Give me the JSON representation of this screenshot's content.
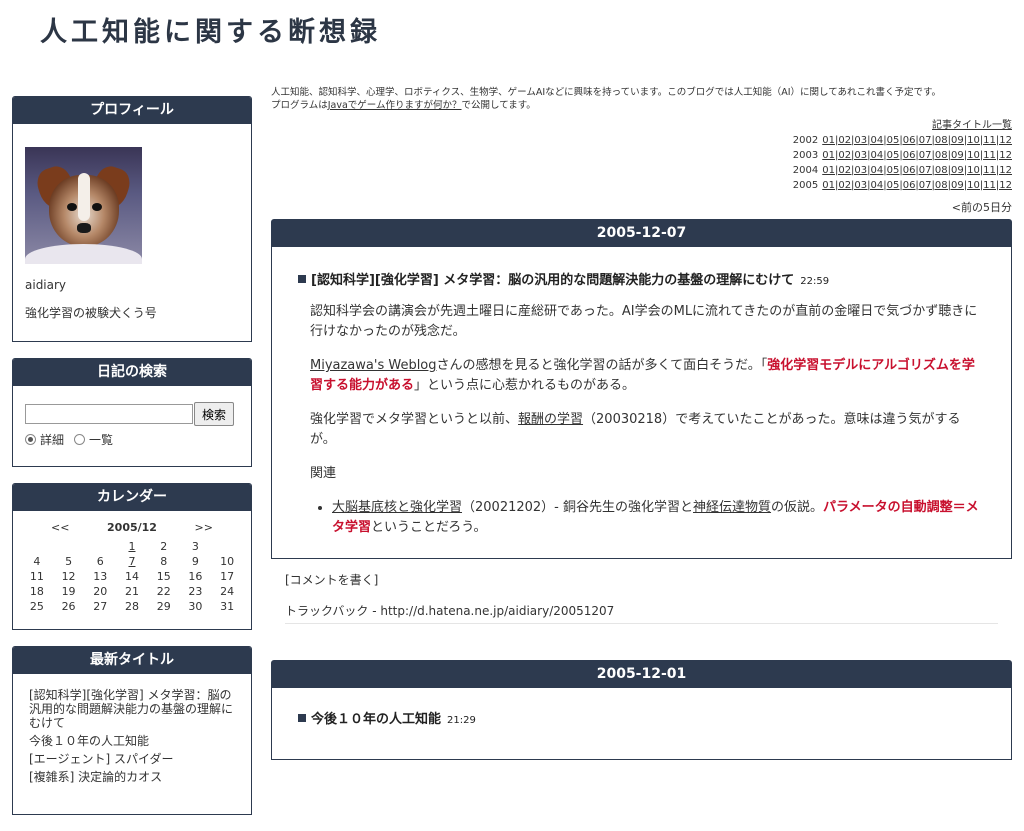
{
  "site": {
    "title": "人工知能に関する断想録"
  },
  "sidebar": {
    "profile": {
      "heading": "プロフィール",
      "name": "aidiary",
      "description": "強化学習の被験犬くう号"
    },
    "search": {
      "heading": "日記の検索",
      "input_value": "",
      "button_label": "検索",
      "options": [
        "詳細",
        "一覧"
      ],
      "selected": "詳細"
    },
    "calendar": {
      "heading": "カレンダー",
      "prev": "<<",
      "month": "2005/12",
      "next": ">>",
      "weeks": [
        [
          "",
          "",
          "",
          "1",
          "2",
          "3",
          ""
        ],
        [
          "4",
          "5",
          "6",
          "7",
          "8",
          "9",
          "10"
        ],
        [
          "11",
          "12",
          "13",
          "14",
          "15",
          "16",
          "17"
        ],
        [
          "18",
          "19",
          "20",
          "21",
          "22",
          "23",
          "24"
        ],
        [
          "25",
          "26",
          "27",
          "28",
          "29",
          "30",
          "31"
        ]
      ]
    },
    "recent": {
      "heading": "最新タイトル",
      "items": [
        "[認知科学][強化学習] メタ学習：脳の汎用的な問題解決能力の基盤の理解にむけて",
        "今後１０年の人工知能",
        "[エージェント] スパイダー",
        "[複雑系] 決定論的カオス"
      ]
    }
  },
  "main": {
    "intro_line1": "人工知能、認知科学、心理学、ロボティクス、生物学、ゲームAIなどに興味を持っています。このブログでは人工知能（AI）に関してあれこれ書く予定です。",
    "intro_prefix": "プログラムは",
    "intro_link": "Javaでゲーム作りますが何か？",
    "intro_suffix": "で公開してます。",
    "archive_title": "記事タイトル一覧",
    "archive_rows": [
      {
        "year": "2002",
        "months": "01|02|03|04|05|06|07|08|09|10|11|12"
      },
      {
        "year": "2003",
        "months": "01|02|03|04|05|06|07|08|09|10|11|12"
      },
      {
        "year": "2004",
        "months": "01|02|03|04|05|06|07|08|09|10|11|12"
      },
      {
        "year": "2005",
        "months": "01|02|03|04|05|06|07|08|09|10|11|12"
      }
    ],
    "prev_link": "<前の5日分",
    "day1": {
      "date": "2005-12-07",
      "title": "[認知科学][強化学習] メタ学習：脳の汎用的な問題解決能力の基盤の理解にむけて",
      "time": "22:59",
      "p1": "認知科学会の講演会が先週土曜日に産総研であった。AI学会のMLに流れてきたのが直前の金曜日で気づかず聴きに行けなかったのが残念だ。",
      "p2_link": "Miyazawa's Weblog",
      "p2_mid": "さんの感想を見ると強化学習の話が多くて面白そうだ。「",
      "p2_red": "強化学習モデルにアルゴリズムを学習する能力がある",
      "p2_end": "」という点に心惹かれるものがある。",
      "p3_a": "強化学習でメタ学習というと以前、",
      "p3_link": "報酬の学習",
      "p3_b": "（20030218）で考えていたことがあった。意味は違う気がするが。",
      "p4": "関連",
      "li_link1": "大脳基底核と強化学習",
      "li_a": "（20021202）- 銅谷先生の強化学習と",
      "li_link2": "神経伝達物質",
      "li_b": "の仮説。",
      "li_red": "パラメータの自動調整＝メタ学習",
      "li_c": "ということだろう。",
      "comment_link": "[コメントを書く]",
      "trackback": "トラックバック - http://d.hatena.ne.jp/aidiary/20051207"
    },
    "day2": {
      "date": "2005-12-01",
      "title": "今後１０年の人工知能",
      "time": "21:29"
    }
  }
}
